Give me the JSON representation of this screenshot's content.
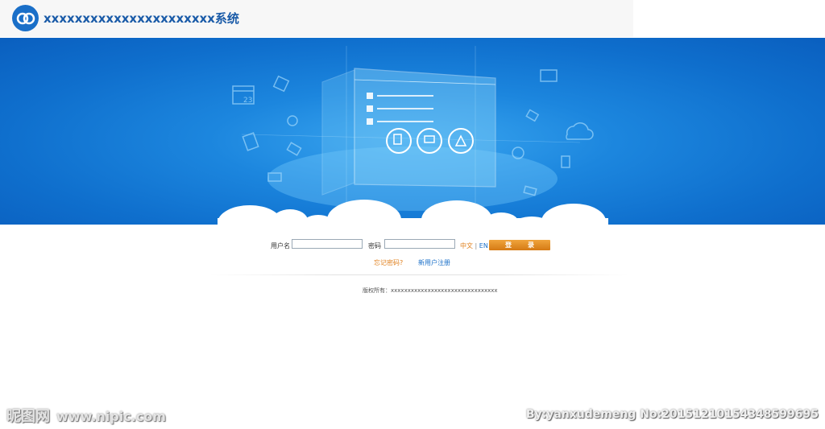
{
  "header": {
    "title": "xxxxxxxxxxxxxxxxxxxxxx系统",
    "logo_icon": "cloud-logo-icon"
  },
  "banner": {
    "calendar_day": "23"
  },
  "login": {
    "username_label": "用户名",
    "username_value": "",
    "password_label": "密码",
    "password_value": "",
    "lang_zh": "中文",
    "lang_sep": "|",
    "lang_en": "EN",
    "login_button": "登录"
  },
  "links": {
    "forgot_password": "忘记密码?",
    "register": "新用户注册"
  },
  "footer": {
    "copyright": "版权所有：xxxxxxxxxxxxxxxxxxxxxxxxxxxxxxxx"
  },
  "watermark": {
    "site_name": "昵图网",
    "site_url": "www.nipic.com",
    "credit": "By:yanxudemeng No:20151210154348599695"
  },
  "colors": {
    "brand_blue": "#1a6fc8",
    "accent_orange": "#e0801e",
    "banner_blue": "#1c86de"
  }
}
